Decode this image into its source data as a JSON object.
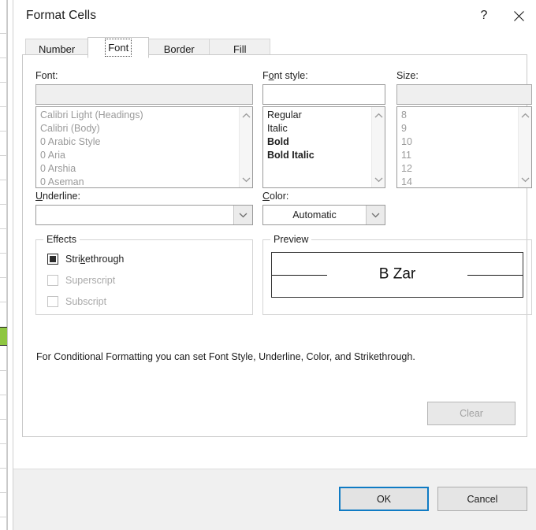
{
  "backdrop": {
    "note": "excel-grid"
  },
  "window": {
    "title": "Format Cells",
    "help_label": "?",
    "close_label": "✕"
  },
  "tabs": [
    {
      "label": "Number",
      "selected": false
    },
    {
      "label": "Font",
      "selected": true
    },
    {
      "label": "Border",
      "selected": false
    },
    {
      "label": "Fill",
      "selected": false
    }
  ],
  "font_section": {
    "label": "Font:",
    "value": "",
    "items": [
      "Calibri Light (Headings)",
      "Calibri (Body)",
      "0 Arabic Style",
      "0 Aria",
      "0 Arshia",
      "0 Aseman"
    ]
  },
  "font_style_section": {
    "label_prefix": "F",
    "label_accel": "o",
    "label_suffix": "nt style:",
    "label": "Font style:",
    "value": "",
    "items": [
      "Regular",
      "Italic",
      "Bold",
      "Bold Italic"
    ]
  },
  "size_section": {
    "label": "Size:",
    "value": "",
    "items": [
      "8",
      "9",
      "10",
      "11",
      "12",
      "14"
    ]
  },
  "underline_section": {
    "label_accel": "U",
    "label_suffix": "nderline:",
    "label": "Underline:",
    "value": ""
  },
  "color_section": {
    "label_accel": "C",
    "label_suffix": "olor:",
    "label": "Color:",
    "value": "Automatic"
  },
  "effects": {
    "title": "Effects",
    "items": [
      {
        "label": "Strikethrough",
        "state": "mixed",
        "enabled": true,
        "accel_before": "Stri",
        "accel": "k",
        "accel_after": "ethrough"
      },
      {
        "label": "Superscript",
        "state": "off",
        "enabled": false
      },
      {
        "label": "Subscript",
        "state": "off",
        "enabled": false
      }
    ]
  },
  "preview": {
    "title": "Preview",
    "sample_text": "B Zar"
  },
  "description": "For Conditional Formatting you can set Font Style, Underline, Color, and Strikethrough.",
  "buttons": {
    "clear": "Clear",
    "ok": "OK",
    "cancel": "Cancel"
  },
  "colors": {
    "accent": "#0f7bc4",
    "backdrop_green": "#8ec641"
  }
}
